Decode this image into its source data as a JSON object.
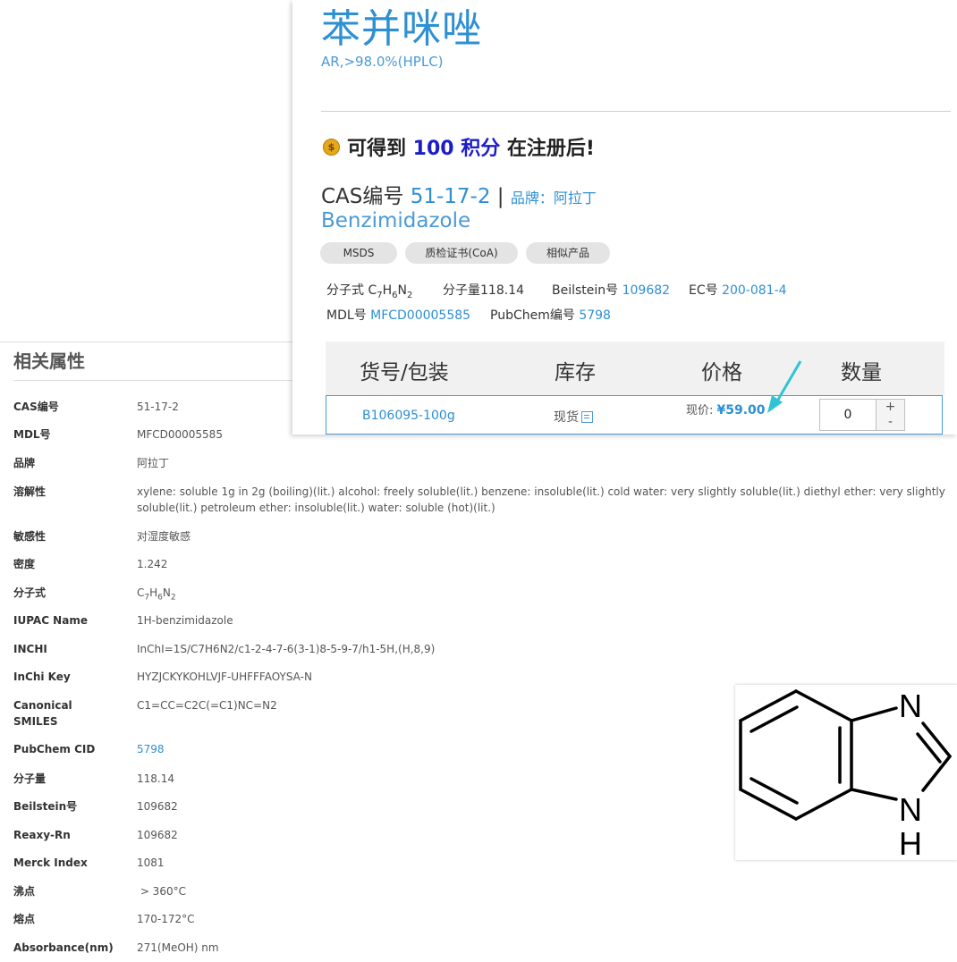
{
  "product": {
    "name_cn": "苯并咪唑",
    "grade": "AR,>98.0%(HPLC)",
    "points": {
      "prefix": "可得到 ",
      "value": "100 积分",
      "suffix": " 在注册后!"
    },
    "cas_label": "CAS编号 ",
    "cas_value": "51-17-2",
    "separator": " | ",
    "brand_label": "品牌：",
    "brand_value": "阿拉丁",
    "name_en": "Benzimidazole",
    "buttons": [
      "MSDS",
      "质检证书(CoA)",
      "相似产品"
    ],
    "formula_label": "分子式 ",
    "mw_label": "分子量118.14",
    "beilstein_label": "Beilstein号 ",
    "beilstein_value": "109682",
    "ec_label": "EC号 ",
    "ec_value": "200-081-4",
    "mdl_label": "MDL号 ",
    "mdl_value": "MFCD00005585",
    "pubchem_label": "PubChem编号 ",
    "pubchem_value": "5798"
  },
  "table": {
    "headers": [
      "货号/包装",
      "库存",
      "价格",
      "数量"
    ],
    "row": {
      "sku": "B106095-100g",
      "stock": "现货",
      "price_label": "现价: ",
      "price_value": "¥59.00",
      "qty": "0",
      "plus": "+",
      "minus": "-"
    }
  },
  "properties": {
    "title": "相关属性",
    "items": [
      {
        "key": "CAS编号",
        "value": "51-17-2"
      },
      {
        "key": "MDL号",
        "value": "MFCD00005585"
      },
      {
        "key": "品牌",
        "value": "阿拉丁"
      },
      {
        "key": "溶解性",
        "value": "xylene: soluble 1g in 2g (boiling)(lit.) alcohol: freely soluble(lit.) benzene: insoluble(lit.) cold water: very slightly soluble(lit.) diethyl ether: very slightly soluble(lit.) petroleum ether: insoluble(lit.) water: soluble (hot)(lit.)"
      },
      {
        "key": "敏感性",
        "value": "对湿度敏感"
      },
      {
        "key": "密度",
        "value": "1.242"
      },
      {
        "key": "分子式",
        "value": ""
      },
      {
        "key": "IUPAC Name",
        "value": "1H-benzimidazole"
      },
      {
        "key": "INCHI",
        "value": "InChI=1S/C7H6N2/c1-2-4-7-6(3-1)8-5-9-7/h1-5H,(H,8,9)"
      },
      {
        "key": "InChi Key",
        "value": "HYZJCKYKOHLVJF-UHFFFAOYSA-N"
      },
      {
        "key": "Canonical SMILES",
        "value": "C1=CC=C2C(=C1)NC=N2"
      },
      {
        "key": "PubChem CID",
        "value": "5798"
      },
      {
        "key": "分子量",
        "value": "118.14"
      },
      {
        "key": "Beilstein号",
        "value": "109682"
      },
      {
        "key": "Reaxy-Rn",
        "value": "109682"
      },
      {
        "key": "Merck Index",
        "value": "1081"
      },
      {
        "key": "沸点",
        "value": " > 360°C"
      },
      {
        "key": "熔点",
        "value": "170-172°C"
      },
      {
        "key": "Absorbance(nm)",
        "value": "271(MeOH) nm"
      }
    ]
  },
  "formula": {
    "c": "C",
    "c_n": "7",
    "h": "H",
    "h_n": "6",
    "n": "N",
    "n_n": "2"
  },
  "structure": {
    "atoms": [
      "N",
      "N",
      "H"
    ]
  },
  "colors": {
    "accent": "#2e8fd3",
    "points": "#1d1dc8",
    "arrow": "#2fc4d4"
  }
}
